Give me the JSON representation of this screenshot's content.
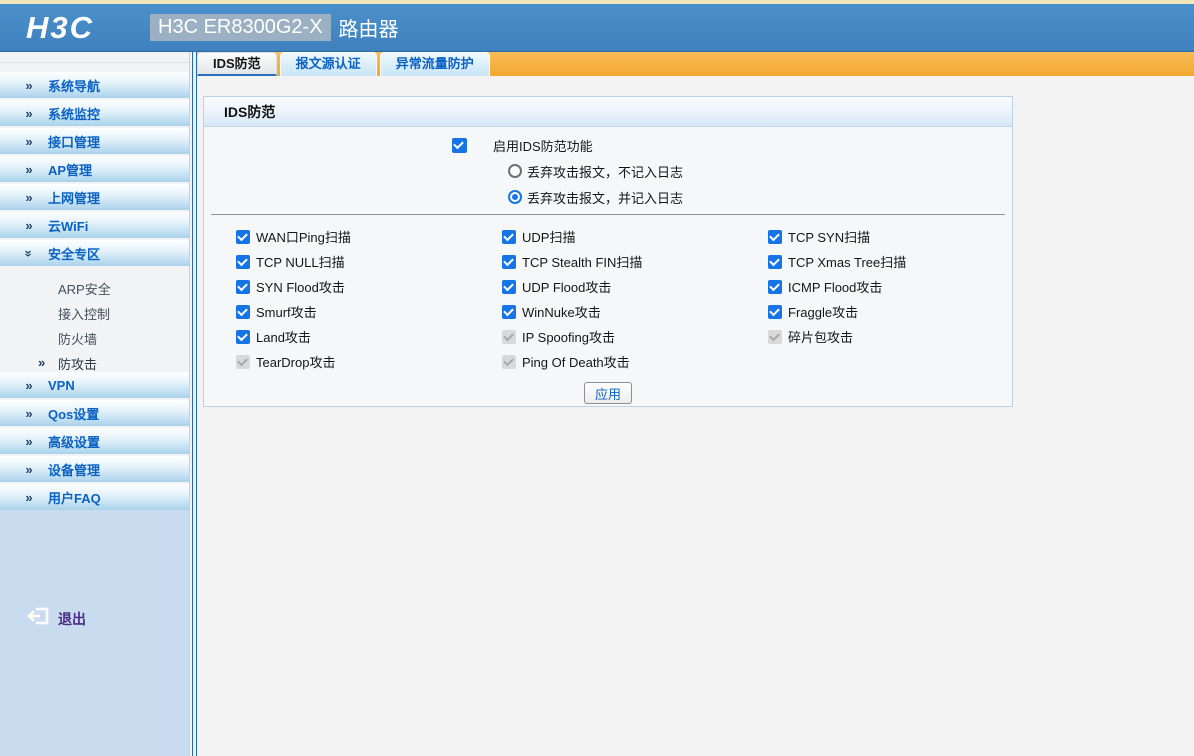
{
  "header": {
    "logo": "H3C",
    "model": "H3C ER8300G2-X",
    "device_type": "路由器"
  },
  "icons": {
    "nav_chevrons": "»",
    "sub_active_arrow": "»"
  },
  "tabs": [
    {
      "label": "IDS防范",
      "active": true
    },
    {
      "label": "报文源认证",
      "active": false
    },
    {
      "label": "异常流量防护",
      "active": false
    }
  ],
  "sidebar": {
    "items_top": [
      {
        "label": "系统导航",
        "expanded": false
      },
      {
        "label": "系统监控",
        "expanded": false
      },
      {
        "label": "接口管理",
        "expanded": false
      },
      {
        "label": "AP管理",
        "expanded": false
      },
      {
        "label": "上网管理",
        "expanded": false
      },
      {
        "label": "云WiFi",
        "expanded": false
      },
      {
        "label": "安全专区",
        "expanded": true
      }
    ],
    "submenu": [
      {
        "label": "ARP安全",
        "active": false
      },
      {
        "label": "接入控制",
        "active": false
      },
      {
        "label": "防火墙",
        "active": false
      },
      {
        "label": "防攻击",
        "active": true
      }
    ],
    "items_bottom": [
      {
        "label": "VPN",
        "expanded": false
      },
      {
        "label": "Qos设置",
        "expanded": false
      },
      {
        "label": "高级设置",
        "expanded": false
      },
      {
        "label": "设备管理",
        "expanded": false
      },
      {
        "label": "用户FAQ",
        "expanded": false
      }
    ],
    "logout_label": "退出"
  },
  "panel": {
    "title": "IDS防范",
    "enable": {
      "label": "启用IDS防范功能",
      "checked": true
    },
    "radios": [
      {
        "label": "丢弃攻击报文，不记入日志",
        "checked": false
      },
      {
        "label": "丢弃攻击报文，并记入日志",
        "checked": true
      }
    ],
    "grid": [
      {
        "label": "WAN口Ping扫描",
        "checked": true,
        "disabled": false
      },
      {
        "label": "UDP扫描",
        "checked": true,
        "disabled": false
      },
      {
        "label": "TCP SYN扫描",
        "checked": true,
        "disabled": false
      },
      {
        "label": "TCP NULL扫描",
        "checked": true,
        "disabled": false
      },
      {
        "label": "TCP Stealth FIN扫描",
        "checked": true,
        "disabled": false
      },
      {
        "label": "TCP Xmas Tree扫描",
        "checked": true,
        "disabled": false
      },
      {
        "label": "SYN Flood攻击",
        "checked": true,
        "disabled": false
      },
      {
        "label": "UDP Flood攻击",
        "checked": true,
        "disabled": false
      },
      {
        "label": "ICMP Flood攻击",
        "checked": true,
        "disabled": false
      },
      {
        "label": "Smurf攻击",
        "checked": true,
        "disabled": false
      },
      {
        "label": "WinNuke攻击",
        "checked": true,
        "disabled": false
      },
      {
        "label": "Fraggle攻击",
        "checked": true,
        "disabled": false
      },
      {
        "label": "Land攻击",
        "checked": true,
        "disabled": false
      },
      {
        "label": "IP Spoofing攻击",
        "checked": true,
        "disabled": true
      },
      {
        "label": "碎片包攻击",
        "checked": true,
        "disabled": true
      },
      {
        "label": "TearDrop攻击",
        "checked": true,
        "disabled": true
      },
      {
        "label": "Ping Of Death攻击",
        "checked": true,
        "disabled": true
      }
    ],
    "apply_label": "应用"
  },
  "colors": {
    "header_blue": "#4189c6",
    "top_strip_cream": "#f2e5b9",
    "tab_bar_orange": "#f4a832",
    "sidebar_footer_blue": "#c9dcef",
    "link_blue": "#0b62c4",
    "checkbox_blue": "#1574e6",
    "logout_purple": "#4a2b86"
  }
}
